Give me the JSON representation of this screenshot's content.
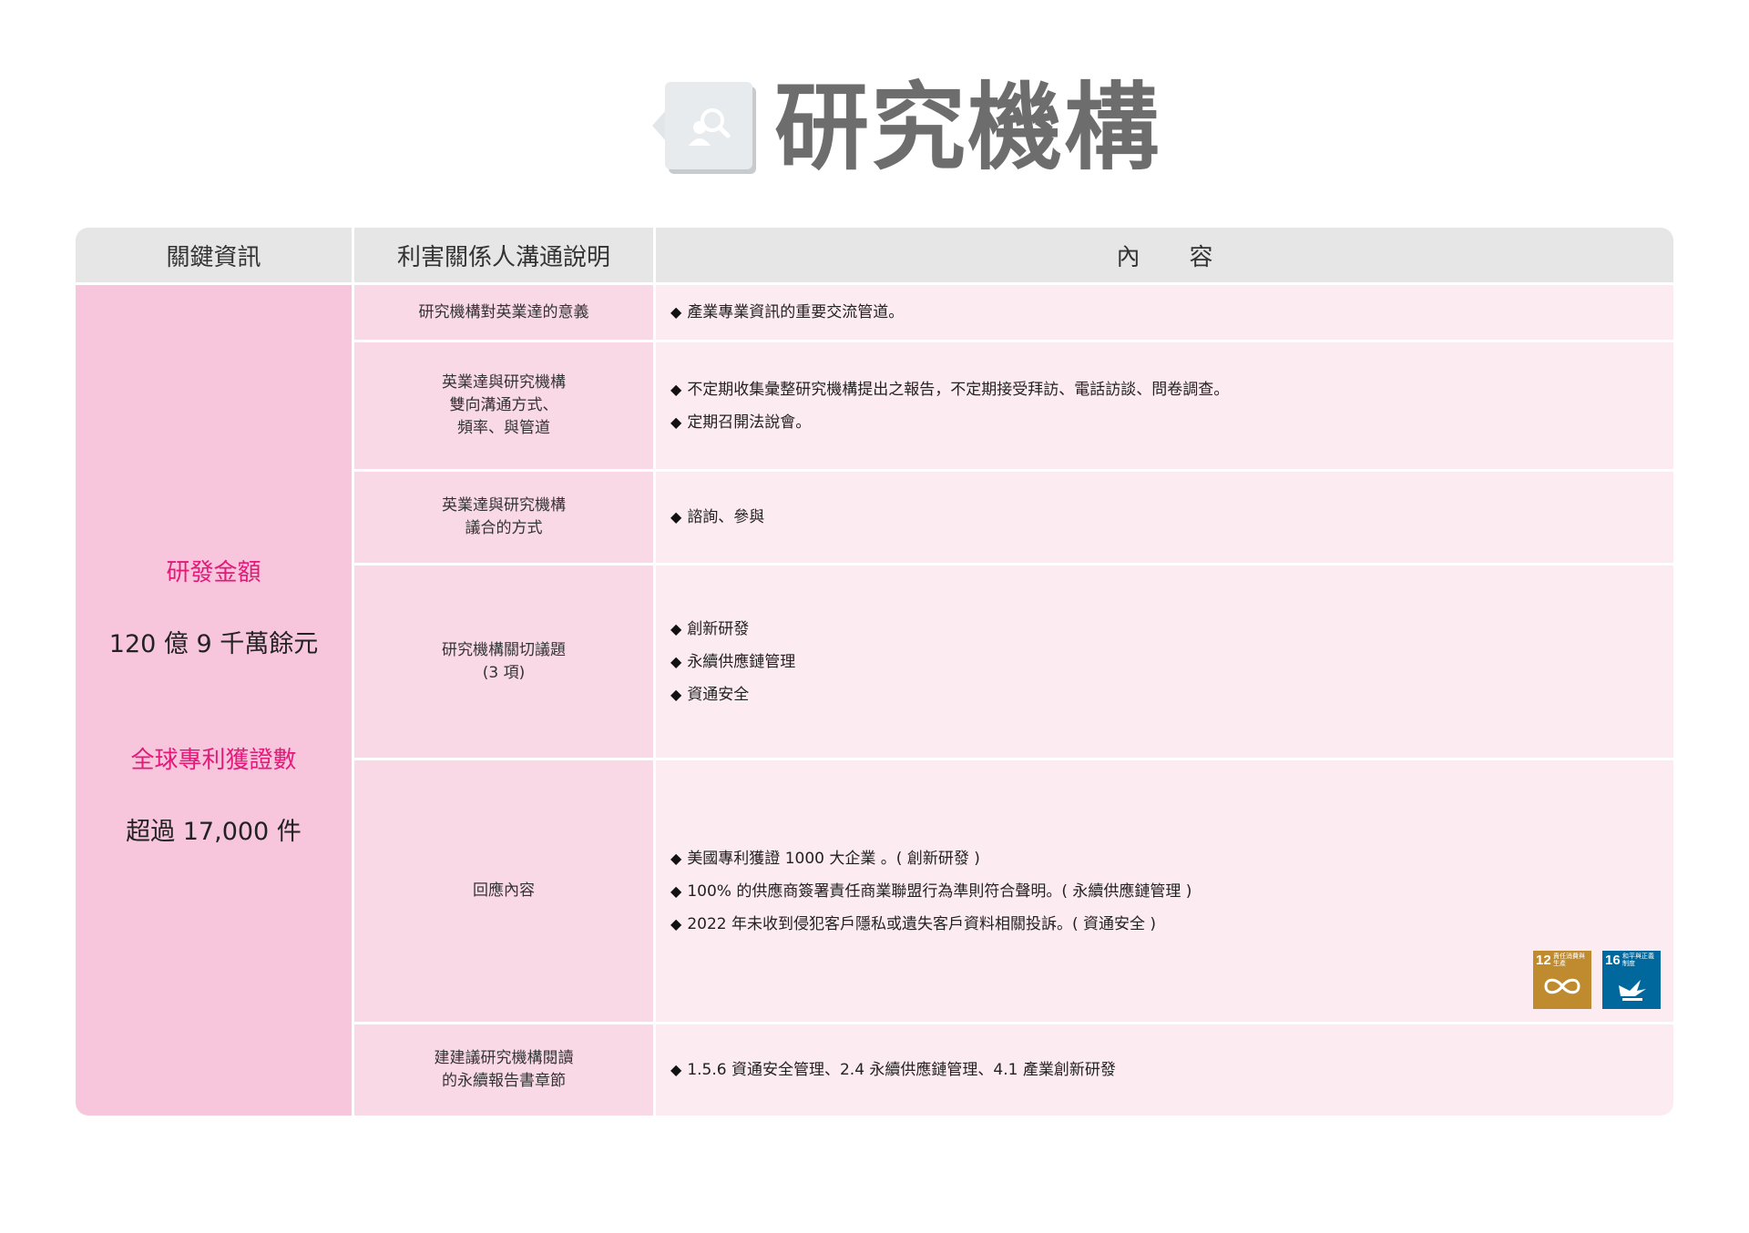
{
  "title": "研究機構",
  "title_icon": "search-person-icon",
  "colors": {
    "pink_key": "#f7c5dc",
    "pink_desc": "#f9d9e6",
    "pink_content": "#fdebf2",
    "accent": "#e4197a",
    "header": "#e6e6e6"
  },
  "headers": {
    "key_info": "關鍵資訊",
    "stakeholder": "利害關係人溝通說明",
    "content": "內容"
  },
  "key_info": {
    "rd_label": "研發金額",
    "rd_value": "120 億 9 千萬餘元",
    "patent_label": "全球專利獲證數",
    "patent_value": "超過 17,000 件"
  },
  "rows": [
    {
      "desc": [
        "研究機構對英業達的意義"
      ],
      "bullets": [
        "產業專業資訊的重要交流管道。"
      ]
    },
    {
      "desc": [
        "英業達與研究機構",
        "雙向溝通方式、",
        "頻率、與管道"
      ],
      "bullets": [
        "不定期收集彙整研究機構提出之報告，不定期接受拜訪、電話訪談、問卷調查。",
        "定期召開法說會。"
      ]
    },
    {
      "desc": [
        "英業達與研究機構",
        "議合的方式"
      ],
      "bullets": [
        "諮詢、參與"
      ]
    },
    {
      "desc": [
        "研究機構關切議題",
        "(3 項)"
      ],
      "bullets": [
        "創新研發",
        "永續供應鏈管理",
        "資通安全"
      ]
    },
    {
      "desc": [
        "回應內容"
      ],
      "bullets": [
        "美國專利獲證 1000 大企業 。( 創新研發 )",
        "100% 的供應商簽署責任商業聯盟行為準則符合聲明。( 永續供應鏈管理 )",
        "2022 年未收到侵犯客戶隱私或遺失客戶資料相關投訴。( 資通安全 )"
      ]
    },
    {
      "desc": [
        "建建議研究機構閱讀",
        "的永續報告書章節"
      ],
      "bullets": [
        "1.5.6  資通安全管理、2.4 永續供應鏈管理、4.1 產業創新研發"
      ]
    }
  ],
  "bullet_symbol": "◆",
  "sdg_badges": [
    {
      "number": "12",
      "label": "責任消費與生產",
      "icon": "infinity-icon",
      "color": "#bf8b2e"
    },
    {
      "number": "16",
      "label": "和平與正義制度",
      "icon": "dove-icon",
      "color": "#00689d"
    }
  ]
}
